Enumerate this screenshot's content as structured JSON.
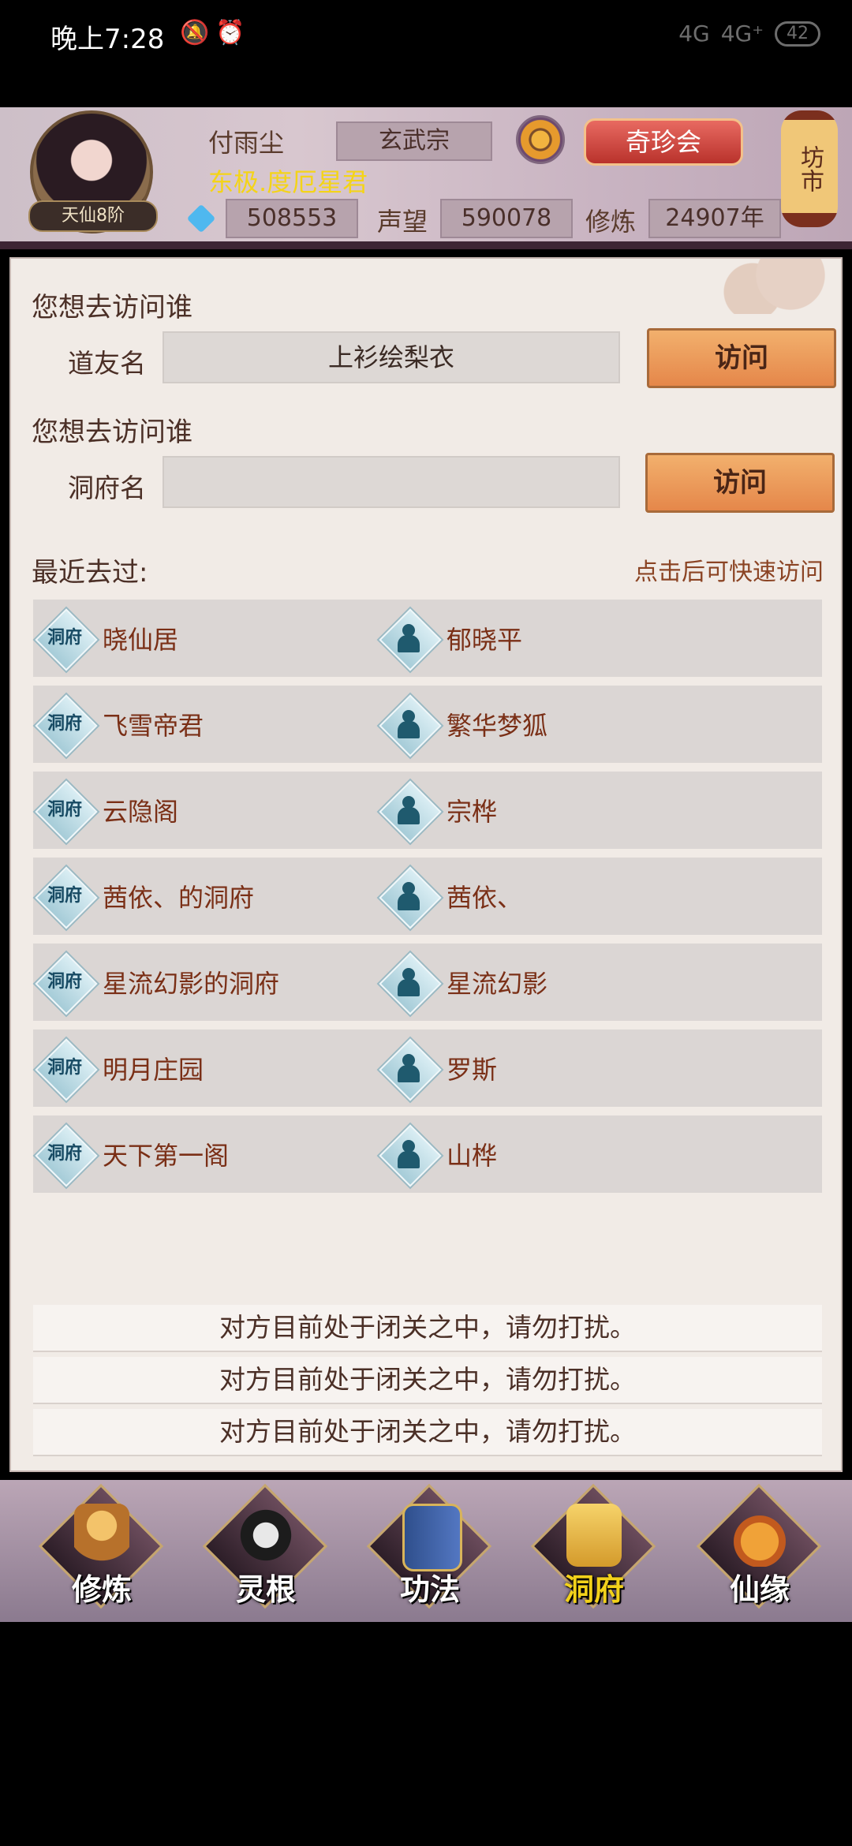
{
  "status_bar": {
    "time": "晚上7:28",
    "icons": "🔕⏰",
    "signal1": "4G",
    "signal2": "4G⁺",
    "battery": "42"
  },
  "header": {
    "player_name": "付雨尘",
    "sect": "玄武宗",
    "title": "东极.度厄星君",
    "rank": "天仙8阶",
    "treasure_button": "奇珍会",
    "market_label": "坊市",
    "spirit_stones": "508553",
    "reputation_label": "声望",
    "reputation_value": "590078",
    "cultivation_label": "修炼",
    "cultivation_value": "24907年"
  },
  "visit": {
    "section1_title": "您想去访问谁",
    "friend_label": "道友名",
    "friend_value": "上衫绘梨衣",
    "visit_button": "访问",
    "section2_title": "您想去访问谁",
    "cave_label": "洞府名",
    "cave_value": ""
  },
  "recent": {
    "title": "最近去过:",
    "tip": "点击后可快速访问",
    "cave_badge": "洞府",
    "rows": [
      {
        "cave": "晓仙居",
        "person": "郁晓平"
      },
      {
        "cave": "飞雪帝君",
        "person": "繁华梦狐"
      },
      {
        "cave": "云隐阁",
        "person": "宗桦"
      },
      {
        "cave": "茜依、的洞府",
        "person": "茜依、"
      },
      {
        "cave": "星流幻影的洞府",
        "person": "星流幻影"
      },
      {
        "cave": "明月庄园",
        "person": "罗斯"
      },
      {
        "cave": "天下第一阁",
        "person": "山桦"
      }
    ]
  },
  "notices": [
    "对方目前处于闭关之中，请勿打扰。",
    "对方目前处于闭关之中，请勿打扰。",
    "对方目前处于闭关之中，请勿打扰。"
  ],
  "bottom_nav": [
    {
      "label": "修炼",
      "active": false
    },
    {
      "label": "灵根",
      "active": false
    },
    {
      "label": "功法",
      "active": false
    },
    {
      "label": "洞府",
      "active": true
    },
    {
      "label": "仙缘",
      "active": false
    }
  ],
  "colors": {
    "accent_gold": "#f4d418",
    "active_nav": "#f2d11a"
  }
}
